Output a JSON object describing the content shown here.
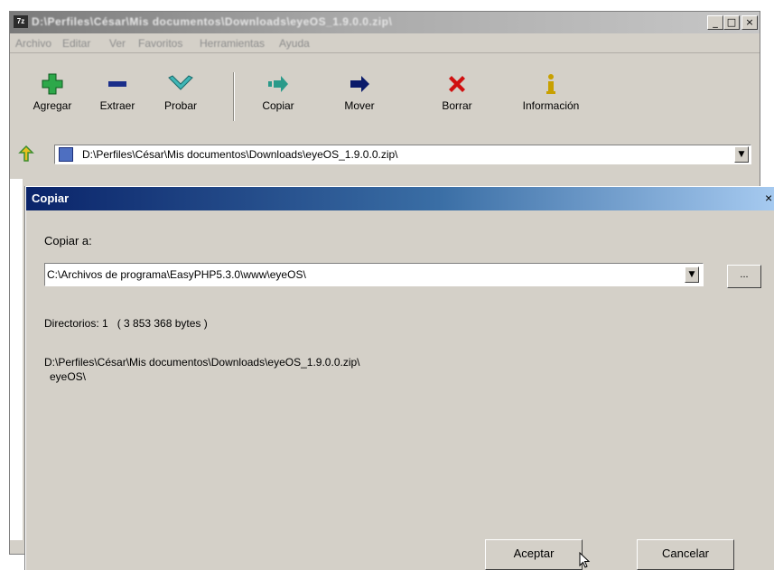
{
  "main_window": {
    "title": "D:\\Perfiles\\César\\Mis documentos\\Downloads\\eyeOS_1.9.0.0.zip\\",
    "icon_label": "7z",
    "caption_buttons": [
      "_",
      "□",
      "×"
    ]
  },
  "menu": {
    "items": [
      "Archivo",
      "Editar",
      "Ver",
      "Favoritos",
      "Herramientas",
      "Ayuda"
    ]
  },
  "toolbar": {
    "buttons": [
      {
        "label": "Agregar",
        "icon": "plus-icon",
        "color": "#2da84a"
      },
      {
        "label": "Extraer",
        "icon": "minus-icon",
        "color": "#1a2e8a"
      },
      {
        "label": "Probar",
        "icon": "check-icon",
        "color": "#3fb6b6"
      },
      {
        "label": "Copiar",
        "icon": "copy-arrow-icon",
        "color": "#2a9a8a"
      },
      {
        "label": "Mover",
        "icon": "move-arrow-icon",
        "color": "#0a1a6a"
      },
      {
        "label": "Borrar",
        "icon": "delete-x-icon",
        "color": "#d01010"
      },
      {
        "label": "Información",
        "icon": "info-icon",
        "color": "#c8a000"
      }
    ]
  },
  "address_bar": {
    "path": "D:\\Perfiles\\César\\Mis documentos\\Downloads\\eyeOS_1.9.0.0.zip\\"
  },
  "dialog": {
    "title": "Copiar",
    "close_glyph": "×",
    "copy_to_label": "Copiar a:",
    "destination": "C:\\Archivos de programa\\EasyPHP5.3.0\\www\\eyeOS\\",
    "browse_label": "...",
    "directories_info": "Directorios: 1   ( 3 853 368 bytes )",
    "source_path": "D:\\Perfiles\\César\\Mis documentos\\Downloads\\eyeOS_1.9.0.0.zip\\",
    "source_item": "eyeOS\\",
    "ok_label": "Aceptar",
    "cancel_label": "Cancelar"
  }
}
